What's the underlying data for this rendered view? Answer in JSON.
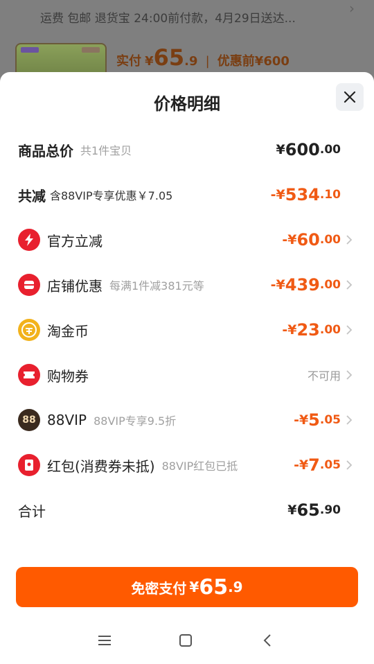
{
  "background": {
    "shipping_line": "运费 包邮 退货宝 24:00前付款，4月29日送达...",
    "price_label": "实付",
    "price_currency": "¥",
    "price_int": "65",
    "price_dec": ".9",
    "price_sep": "|",
    "original_label": "优惠前",
    "original_price": "¥600"
  },
  "sheet": {
    "title": "价格明细"
  },
  "rows": [
    {
      "name": "商品总价",
      "sub": "共1件宝贝",
      "prefix": "¥",
      "int": "600",
      "dec": ".00"
    },
    {
      "name": "共减",
      "sub": "含88VIP专享优惠￥7.05",
      "prefix": "-¥",
      "int": "534",
      "dec": ".10"
    },
    {
      "name": "官方立减",
      "sub": "",
      "prefix": "-¥",
      "int": "60",
      "dec": ".00",
      "icon": "lightning-icon"
    },
    {
      "name": "店铺优惠",
      "sub": "每满1件减381元等",
      "prefix": "-¥",
      "int": "439",
      "dec": ".00",
      "icon": "shop-icon"
    },
    {
      "name": "淘金币",
      "sub": "",
      "prefix": "-¥",
      "int": "23",
      "dec": ".00",
      "icon": "coin-icon"
    },
    {
      "name": "购物券",
      "sub": "",
      "status": "不可用",
      "icon": "coupon-icon"
    },
    {
      "name": "88VIP",
      "sub": "88VIP专享9.5折",
      "prefix": "-¥",
      "int": "5",
      "dec": ".05",
      "icon": "vip88-icon",
      "icon_text": "88"
    },
    {
      "name": "红包(消费券未抵)",
      "sub": "88VIP红包已抵",
      "prefix": "-¥",
      "int": "7",
      "dec": ".05",
      "icon": "red-packet-icon"
    },
    {
      "name": "合计",
      "sub": "",
      "prefix": "¥",
      "int": "65",
      "dec": ".90"
    }
  ],
  "pay_button": {
    "label": "免密支付",
    "prefix": "¥",
    "int": "65",
    "dec": ".9"
  },
  "colors": {
    "accent": "#ff5a00",
    "discount": "#f05a14",
    "icon_red": "#e8202e",
    "icon_gold": "#f2b21c",
    "icon_dark": "#3a2a1e"
  }
}
